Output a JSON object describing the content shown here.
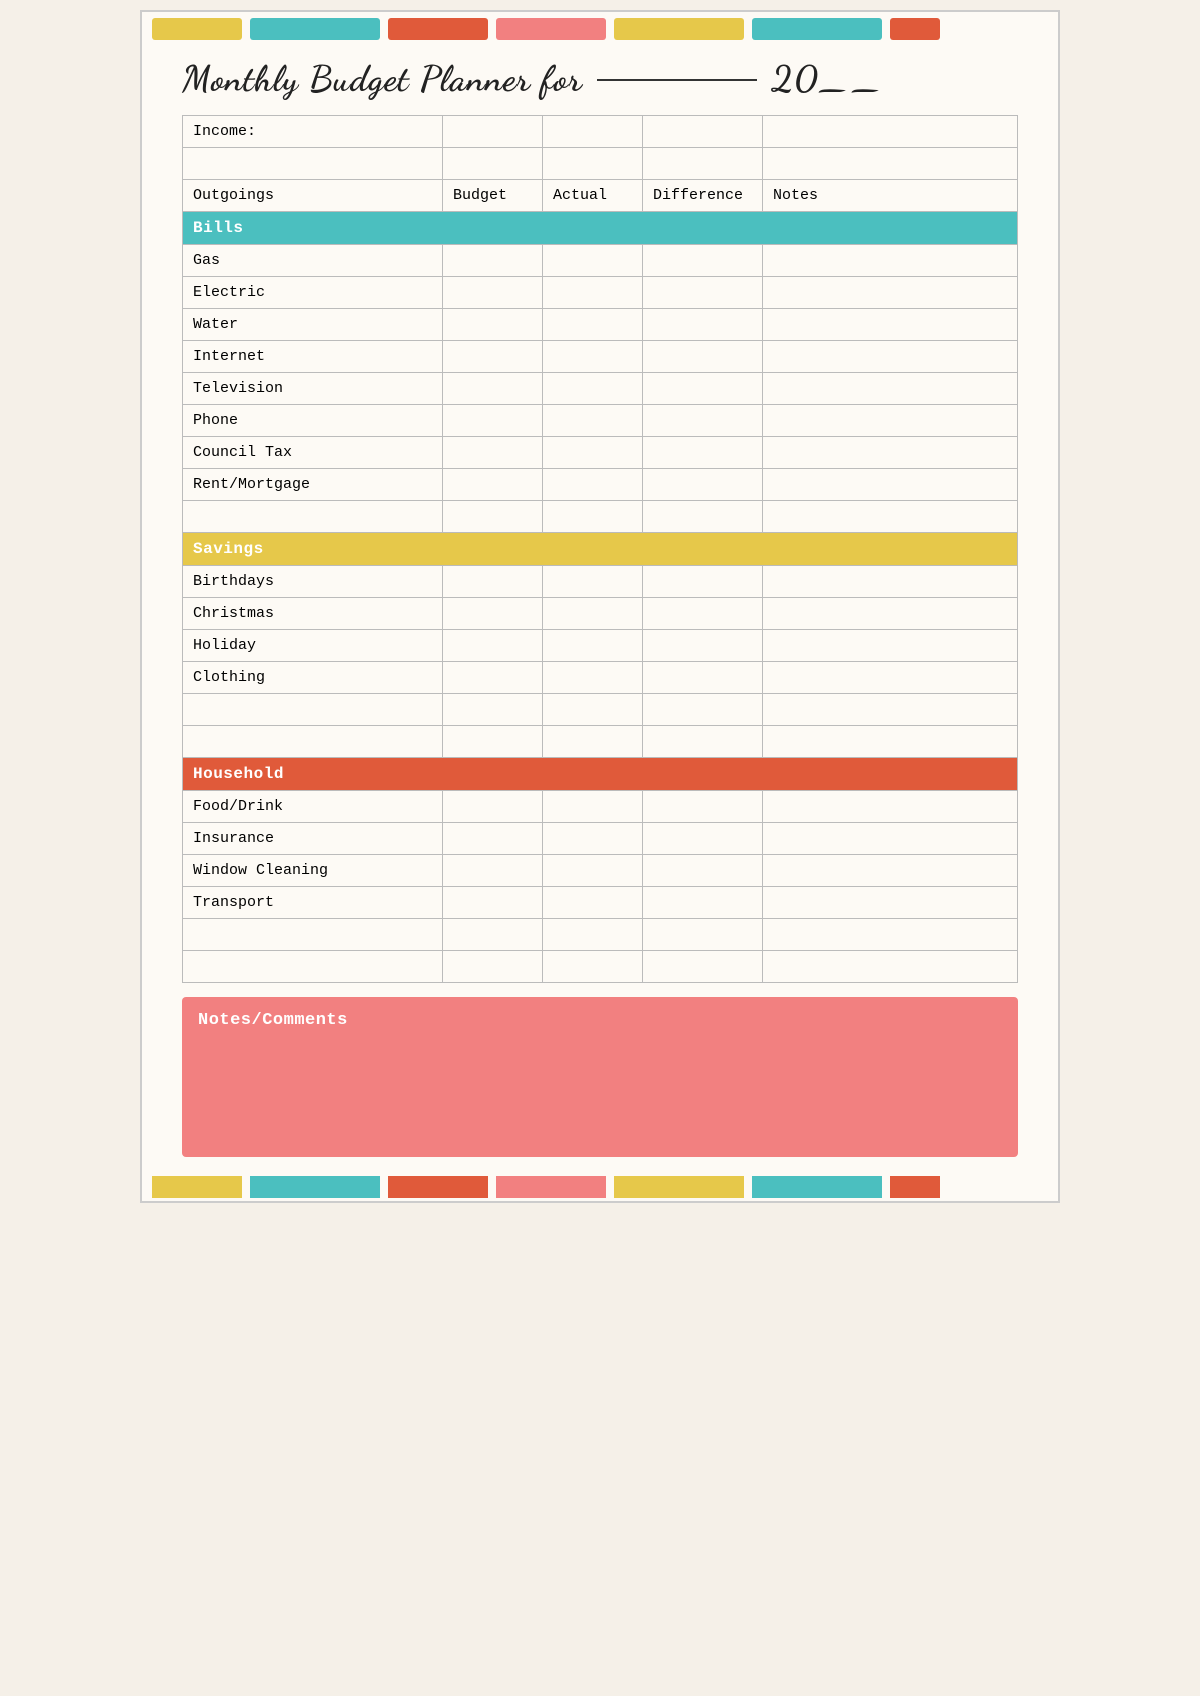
{
  "title": {
    "main": "Monthly Budget Planner for",
    "line_placeholder": "___________",
    "year_prefix": "20",
    "year_suffix": "__"
  },
  "color_bars": {
    "top": [
      "#e6c84a",
      "#4bbfbf",
      "#e05a3a",
      "#f28080",
      "#e6c84a",
      "#4bbfbf",
      "#e05a3a"
    ],
    "bottom": [
      "#e6c84a",
      "#4bbfbf",
      "#e05a3a",
      "#f28080",
      "#e6c84a",
      "#4bbfbf",
      "#e05a3a"
    ]
  },
  "table": {
    "income_label": "Income:",
    "headers": {
      "outgoings": "Outgoings",
      "budget": "Budget",
      "actual": "Actual",
      "difference": "Difference",
      "notes": "Notes"
    },
    "sections": [
      {
        "name": "Bills",
        "color": "#4bbfbf",
        "items": [
          "Gas",
          "Electric",
          "Water",
          "Internet",
          "Television",
          "Phone",
          "Council Tax",
          "Rent/Mortgage"
        ]
      },
      {
        "name": "Savings",
        "color": "#e6c84a",
        "items": [
          "Birthdays",
          "Christmas",
          "Holiday",
          "Clothing"
        ]
      },
      {
        "name": "Household",
        "color": "#e05a3a",
        "items": [
          "Food/Drink",
          "Insurance",
          "Window Cleaning",
          "Transport"
        ]
      }
    ]
  },
  "notes": {
    "title": "Notes/Comments"
  }
}
